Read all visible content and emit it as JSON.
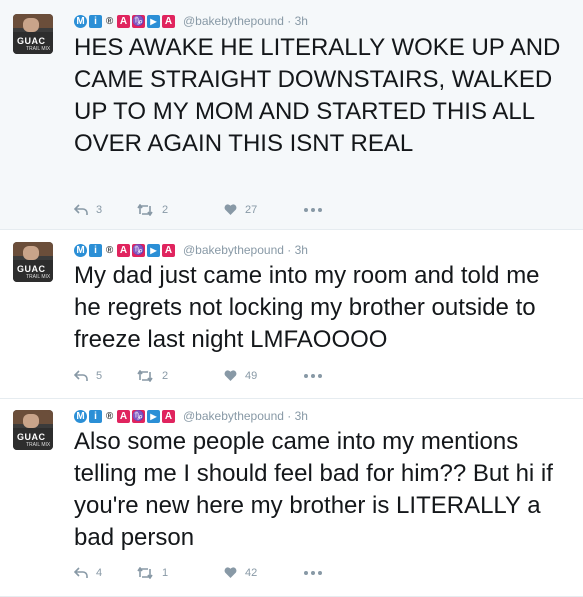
{
  "author": {
    "badges": [
      "M",
      "i",
      "®",
      "A",
      "♑",
      "▶",
      "A"
    ],
    "handle": "@bakebythepound · 3h",
    "avatar_text": "GUAC",
    "avatar_subtext": "TRAIL MIX"
  },
  "tweets": [
    {
      "text": "HES AWAKE HE LITERALLY WOKE UP AND CAME STRAIGHT DOWNSTAIRS, WALKED UP TO MY MOM AND STARTED THIS ALL OVER AGAIN THIS ISNT REAL",
      "replies": "3",
      "retweets": "2",
      "likes": "27"
    },
    {
      "text": "My dad just came into my room and told me he regrets not locking my brother outside to freeze last night LMFAOOOO",
      "replies": "5",
      "retweets": "2",
      "likes": "49"
    },
    {
      "text": "Also some people came into my mentions telling me I should feel bad for him?? But hi if you're new here my brother is LITERALLY a bad person",
      "replies": "4",
      "retweets": "1",
      "likes": "42"
    }
  ],
  "colors": {
    "badge_blue": "#2b8fd6",
    "badge_red": "#e0245e",
    "muted": "#8899a6",
    "text": "#14171a"
  }
}
